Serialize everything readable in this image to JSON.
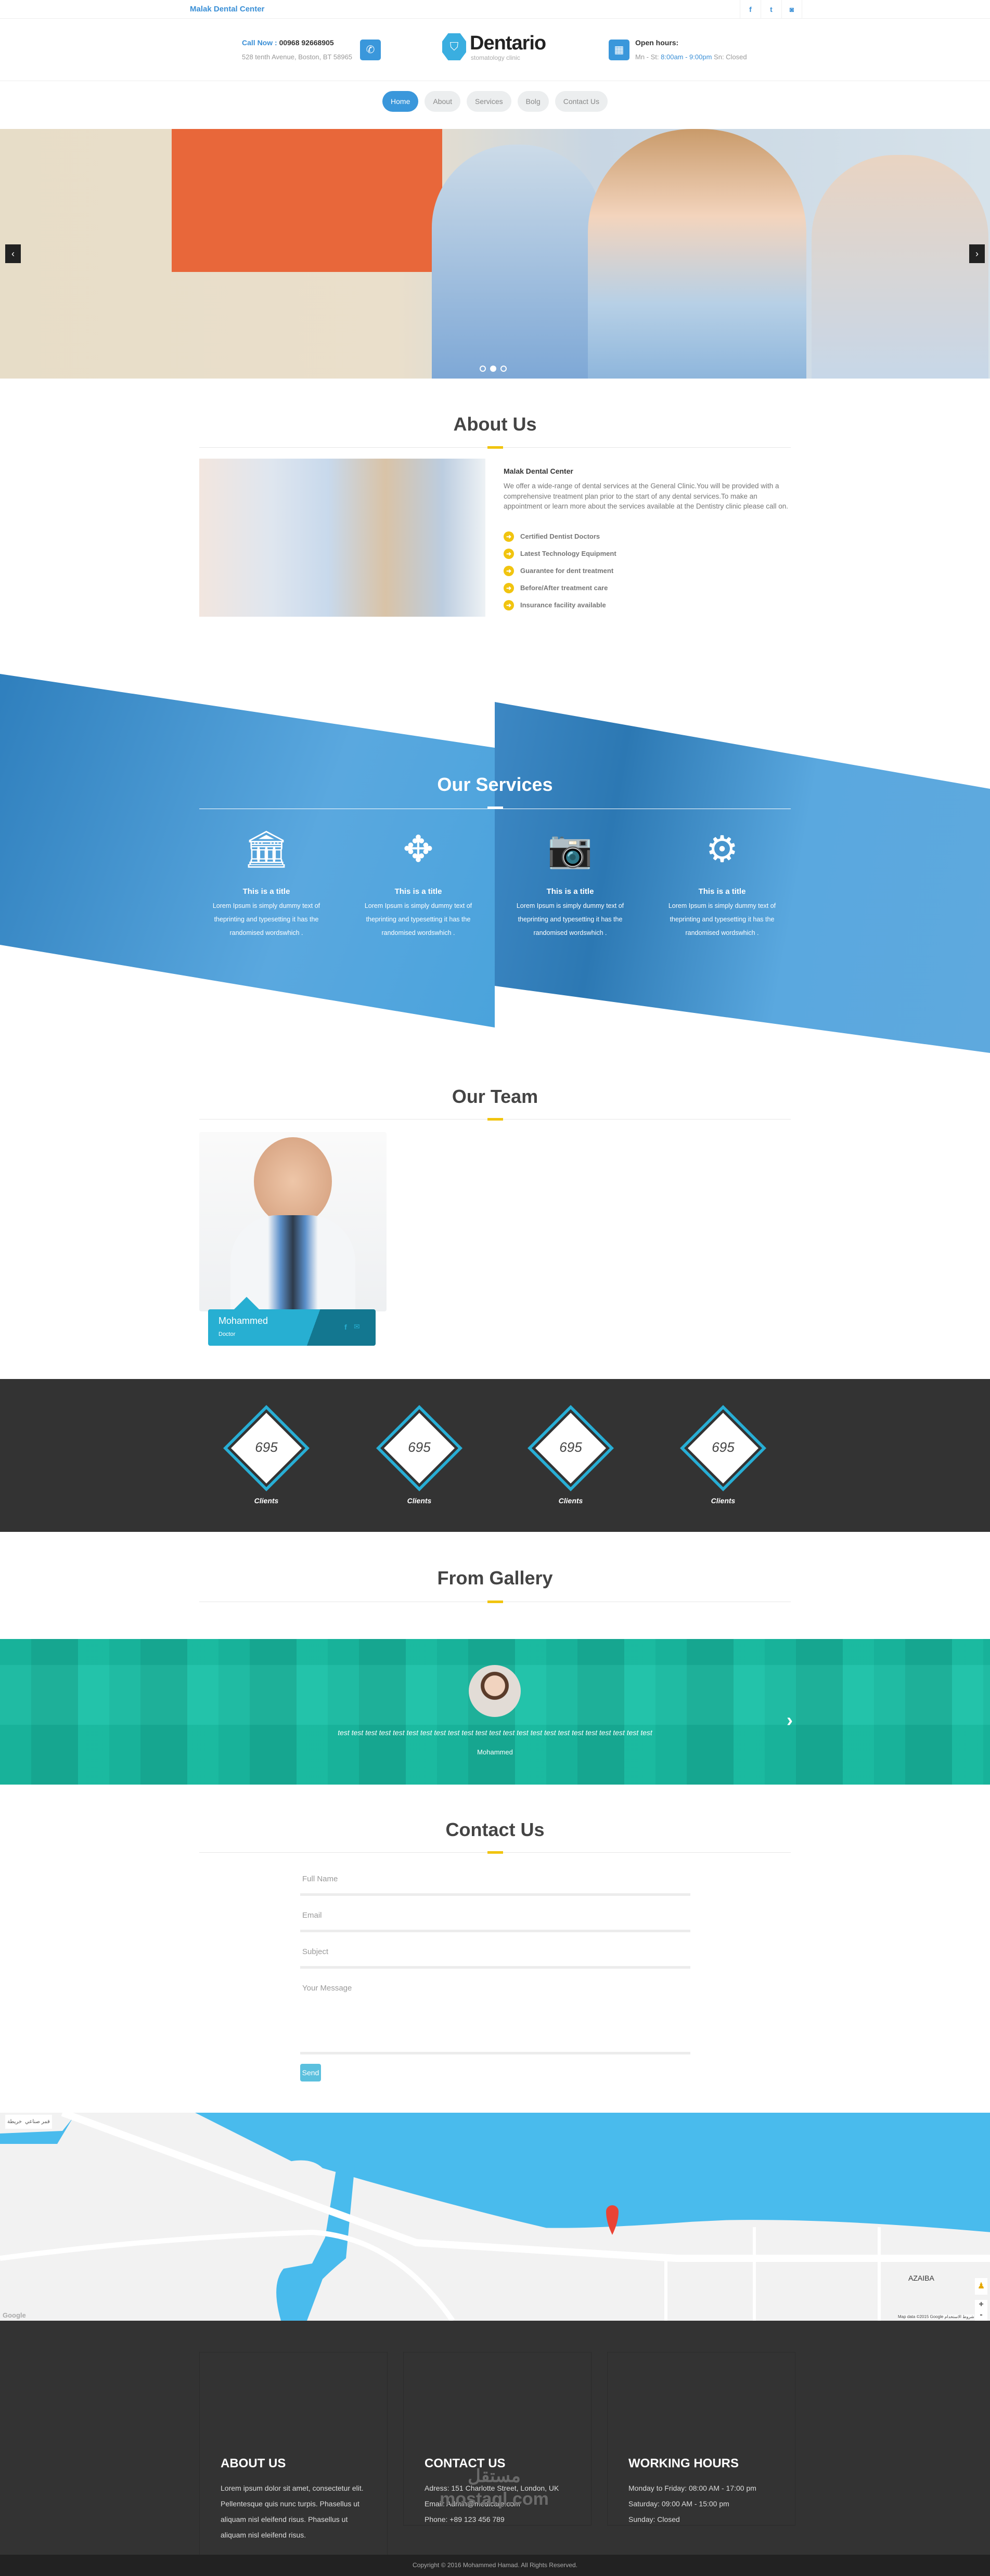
{
  "topbar": {
    "brand": "Malak Dental Center",
    "social": [
      {
        "icon": "facebook-icon",
        "glyph": "f"
      },
      {
        "icon": "twitter-icon",
        "glyph": "t"
      },
      {
        "icon": "instagram-icon",
        "glyph": "◙"
      }
    ]
  },
  "header": {
    "call_label": "Call Now :",
    "phone": "00968 92668905",
    "address": "528 tenth Avenue, Boston, BT 58965",
    "logo_name": "Dentario",
    "logo_tagline": "stomatology clinic",
    "hours_label": "Open hours:",
    "hours_days": "Mn - St:",
    "hours_time": "8:00am - 9:00pm",
    "hours_closed": "Sn: Closed"
  },
  "nav": [
    {
      "label": "Home",
      "active": true
    },
    {
      "label": "About"
    },
    {
      "label": "Services"
    },
    {
      "label": "Bolg"
    },
    {
      "label": "Contact Us"
    }
  ],
  "slider": {
    "prev": "‹",
    "next": "›",
    "dots": 3,
    "active_dot": 1
  },
  "about": {
    "title": "About Us",
    "heading": "Malak Dental Center",
    "text": "We offer a wide-range of dental services at the General Clinic.You will be provided with a comprehensive treatment plan prior to the start of any dental services.To make an appointment or learn more about the services available at the Dentistry clinic please call on.",
    "features": [
      "Certified Dentist Doctors",
      "Latest Technology Equipment",
      "Guarantee for dent treatment",
      "Before/After treatment care",
      "Insurance facility available"
    ]
  },
  "services": {
    "title": "Our Services",
    "items": [
      {
        "icon": "bank-icon",
        "glyph": "🏛",
        "title": "This is a title",
        "text": "Lorem Ipsum is simply dummy text of theprinting and typesetting it has the randomised wordswhich ."
      },
      {
        "icon": "move-arrows-icon",
        "glyph": "✥",
        "title": "This is a title",
        "text": "Lorem Ipsum is simply dummy text of theprinting and typesetting it has the randomised wordswhich ."
      },
      {
        "icon": "camera-icon",
        "glyph": "📷",
        "title": "This is a title",
        "text": "Lorem Ipsum is simply dummy text of theprinting and typesetting it has the randomised wordswhich ."
      },
      {
        "icon": "gear-icon",
        "glyph": "⚙",
        "title": "This is a title",
        "text": "Lorem Ipsum is simply dummy text of theprinting and typesetting it has the randomised wordswhich ."
      }
    ]
  },
  "team": {
    "title": "Our Team",
    "members": [
      {
        "name": "Mohammed",
        "role": "Doctor"
      }
    ]
  },
  "stats": [
    {
      "value": "695",
      "label": "Clients"
    },
    {
      "value": "695",
      "label": "Clients"
    },
    {
      "value": "695",
      "label": "Clients"
    },
    {
      "value": "695",
      "label": "Clients"
    }
  ],
  "gallery": {
    "title": "From Gallery",
    "quote": "test test test test test test test test test test test test test test test test test test test test test test test",
    "name": "Mohammed",
    "next": "›"
  },
  "contact": {
    "title": "Contact Us",
    "full_name": "Full Name",
    "email": "Email",
    "subject": "Subject",
    "message": "Your Message",
    "send": "Send"
  },
  "map": {
    "label_map": "خريطة",
    "label_sat": "قمر صناعي",
    "place": "AZAIBA",
    "attribution": "Map data ©2015 Google",
    "terms": "شروط الاستخدام",
    "logo": "Google",
    "zoom_in": "+",
    "zoom_out": "-"
  },
  "footer": {
    "about": {
      "title": "ABOUT US",
      "text": "Lorem ipsum dolor sit amet, consectetur elit. Pellentesque quis nunc turpis. Phasellus ut aliquam nisl eleifend risus. Phasellus ut aliquam nisl eleifend risus."
    },
    "contact": {
      "title": "CONTACT US",
      "lines": [
        "Adress: 151 Charlotte Street, London, UK",
        "Email: Admin@medicare.com",
        "Phone: +89 123 456 789"
      ]
    },
    "hours": {
      "title": "WORKING HOURS",
      "lines": [
        "Monday to Friday: 08:00 AM - 17:00 pm",
        "Saturday: 09:00 AM - 15:00 pm",
        "Sunday: Closed"
      ]
    },
    "watermark": "مستقل mostaql.com",
    "copyright": "Copyright © 2016 Mohammed Hamad. All Rights Reserved."
  },
  "colors": {
    "primary": "#3a97db",
    "accent": "#f1c40f",
    "teal": "#19b9a0",
    "team": "#27afd2",
    "dark": "#333333"
  }
}
